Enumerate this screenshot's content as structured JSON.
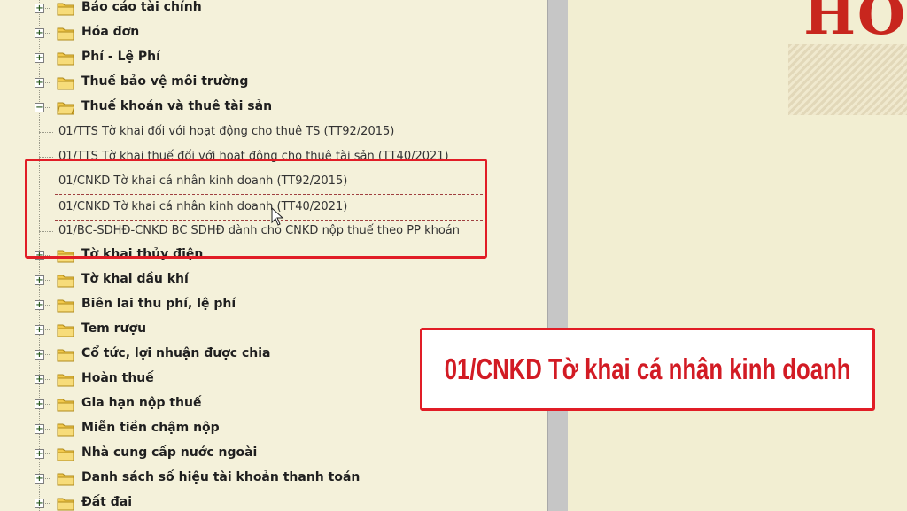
{
  "tree": {
    "top_items": [
      {
        "label": "Báo cáo tài chính",
        "expander": "+"
      },
      {
        "label": "Hóa đơn",
        "expander": "+"
      },
      {
        "label": "Phí - Lệ Phí",
        "expander": "+"
      },
      {
        "label": "Thuế bảo vệ môi trường",
        "expander": "+"
      },
      {
        "label": "Thuế khoán và thuê tài sản",
        "expander": "−"
      }
    ],
    "leaves": [
      {
        "label": "01/TTS Tờ khai đối với hoạt động cho thuê TS (TT92/2015)"
      },
      {
        "label": "01/TTS Tờ khai thuế đối với hoạt động cho thuê tài sản (TT40/2021)"
      },
      {
        "label": "01/CNKD Tờ khai cá nhân kinh doanh (TT92/2015)"
      },
      {
        "label": "01/CNKD Tờ khai cá nhân kinh doanh (TT40/2021)"
      },
      {
        "label": "01/BC-SDHĐ-CNKD BC SDHĐ dành cho CNKD nộp thuế theo PP khoán"
      }
    ],
    "bottom_items": [
      {
        "label": "Tờ khai thủy điện",
        "expander": "+"
      },
      {
        "label": "Tờ khai dầu khí",
        "expander": "+"
      },
      {
        "label": "Biên lai thu phí, lệ phí",
        "expander": "+"
      },
      {
        "label": "Tem rượu",
        "expander": "+"
      },
      {
        "label": "Cổ tức, lợi nhuận được chia",
        "expander": "+"
      },
      {
        "label": "Hoàn thuế",
        "expander": "+"
      },
      {
        "label": "Gia hạn nộp thuế",
        "expander": "+"
      },
      {
        "label": "Miễn tiền chậm nộp",
        "expander": "+"
      },
      {
        "label": "Nhà cung cấp nước ngoài",
        "expander": "+"
      },
      {
        "label": "Danh sách số hiệu tài khoản thanh toán",
        "expander": "+"
      },
      {
        "label": "Đất đai",
        "expander": "+"
      }
    ]
  },
  "logo": {
    "text": "HO"
  },
  "caption": {
    "text": "01/CNKD Tờ khai cá nhân kinh doanh"
  },
  "colors": {
    "accent_red": "#e11d26",
    "folder_yellow": "#f2c94c",
    "background": "#f4f1da"
  },
  "icons": {
    "folder": "folder-icon",
    "expand": "plus-box-icon",
    "collapse": "minus-box-icon",
    "cursor": "mouse-pointer-icon"
  }
}
